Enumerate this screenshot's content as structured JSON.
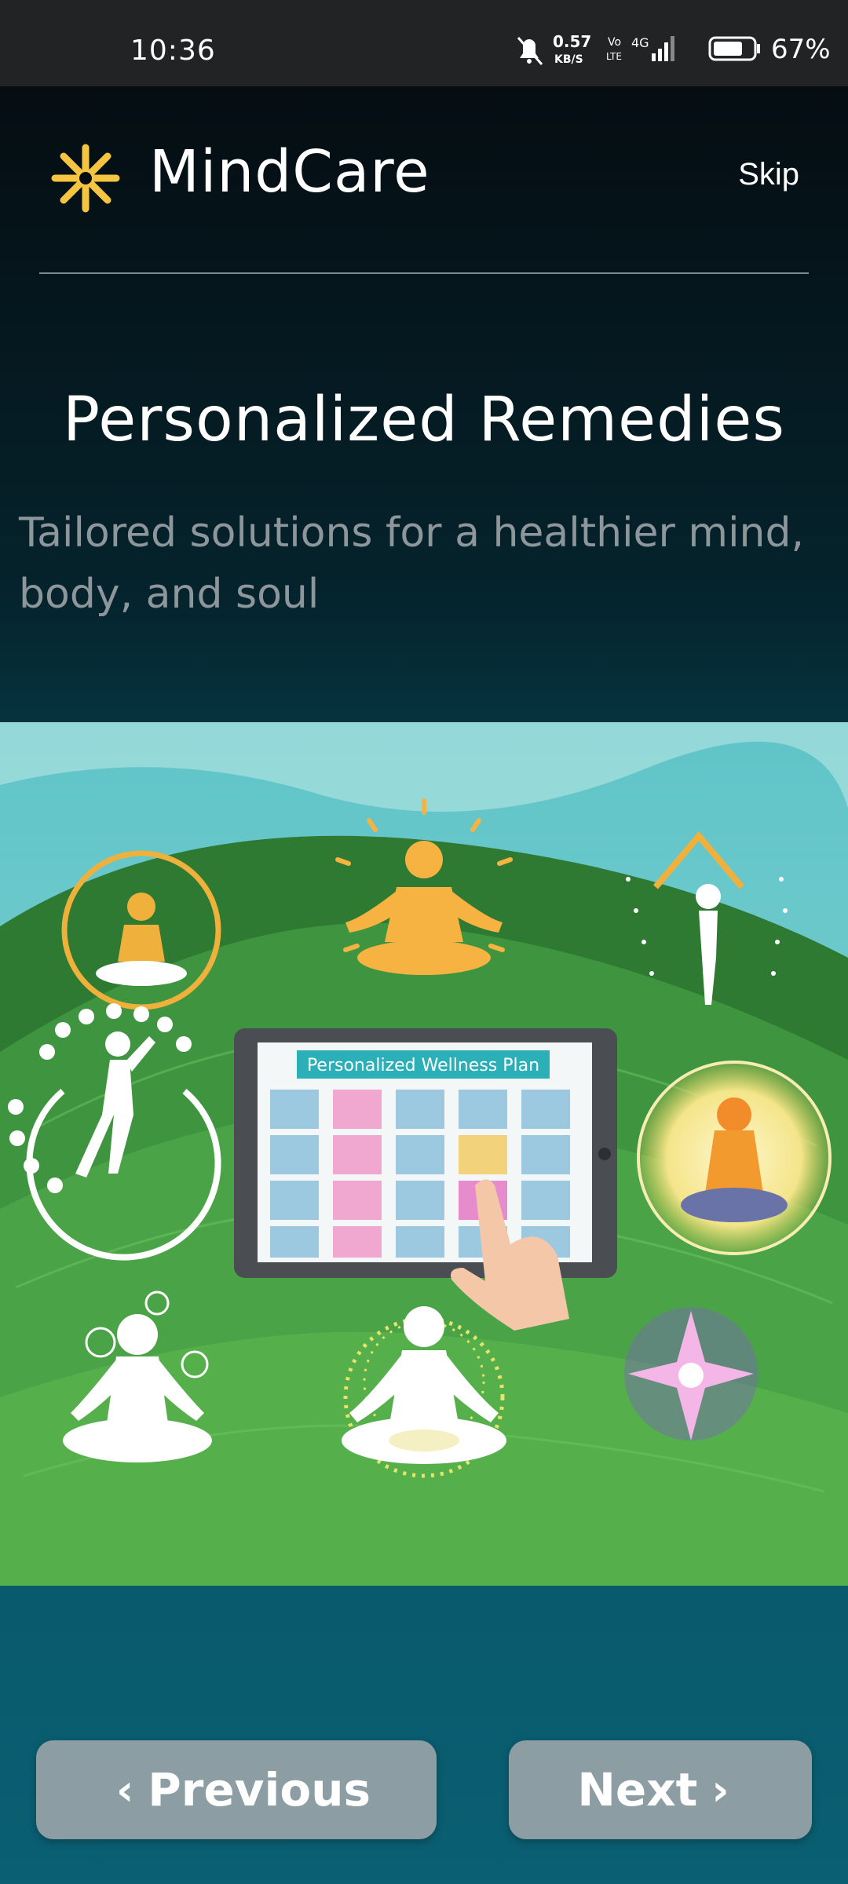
{
  "status_bar": {
    "time": "10:36",
    "net_speed_value": "0.57",
    "net_speed_unit": "KB/S",
    "volte_top": "Vo",
    "volte_bottom": "LTE",
    "network": "4G",
    "battery": "67%",
    "icons": [
      "bell-muted-icon",
      "signal-icon",
      "battery-icon"
    ]
  },
  "header": {
    "app_name": "MindCare",
    "skip_label": "Skip",
    "logo_icon": "asterisk-flower-icon",
    "logo_color": "#f5c542"
  },
  "content": {
    "title": "Personalized Remedies",
    "subtitle": "Tailored solutions for a healthier mind, body, and soul"
  },
  "illustration": {
    "tablet_heading": "Personalized Wellness Plan"
  },
  "nav": {
    "previous_label": "Previous",
    "next_label": "Next",
    "previous_icon": "chevron-left-icon",
    "next_icon": "chevron-right-icon"
  },
  "colors": {
    "accent": "#f5c542",
    "button_bg": "#8c9ea4",
    "tablet_header": "#2bb0b8"
  }
}
